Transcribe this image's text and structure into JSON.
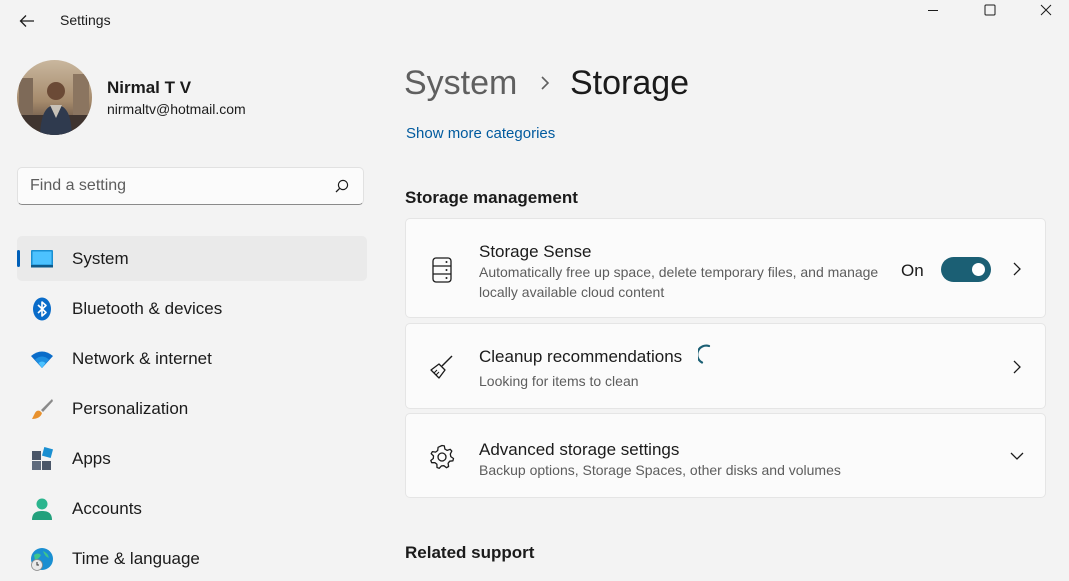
{
  "window": {
    "title": "Settings",
    "controls": {
      "minimize": "minimize-icon",
      "maximize": "maximize-icon",
      "close": "close-icon"
    }
  },
  "profile": {
    "name": "Nirmal T V",
    "email": "nirmaltv@hotmail.com"
  },
  "search": {
    "placeholder": "Find a setting",
    "value": ""
  },
  "nav": {
    "items": [
      {
        "label": "System",
        "icon": "system-monitor-icon",
        "active": true
      },
      {
        "label": "Bluetooth & devices",
        "icon": "bluetooth-icon",
        "active": false
      },
      {
        "label": "Network & internet",
        "icon": "wifi-icon",
        "active": false
      },
      {
        "label": "Personalization",
        "icon": "paintbrush-icon",
        "active": false
      },
      {
        "label": "Apps",
        "icon": "apps-icon",
        "active": false
      },
      {
        "label": "Accounts",
        "icon": "account-icon",
        "active": false
      },
      {
        "label": "Time & language",
        "icon": "globe-clock-icon",
        "active": false
      }
    ]
  },
  "breadcrumb": {
    "parent": "System",
    "current": "Storage"
  },
  "main": {
    "more_link": "Show more categories",
    "section_storage": "Storage management",
    "section_support": "Related support",
    "cards": [
      {
        "title": "Storage Sense",
        "desc": "Automatically free up space, delete temporary files, and manage locally available cloud content",
        "icon": "storage-drive-icon",
        "toggle_label": "On",
        "toggle_on": true
      },
      {
        "title": "Cleanup recommendations",
        "desc": "Looking for items to clean",
        "icon": "broom-icon",
        "loading": true
      },
      {
        "title": "Advanced storage settings",
        "desc": "Backup options, Storage Spaces, other disks and volumes",
        "icon": "gear-icon",
        "expandable": true
      }
    ]
  },
  "colors": {
    "accent": "#005fb8",
    "toggle_on": "#1b5f74",
    "link": "#005a9e",
    "background": "#f3f3f3",
    "card": "#fbfbfb"
  }
}
